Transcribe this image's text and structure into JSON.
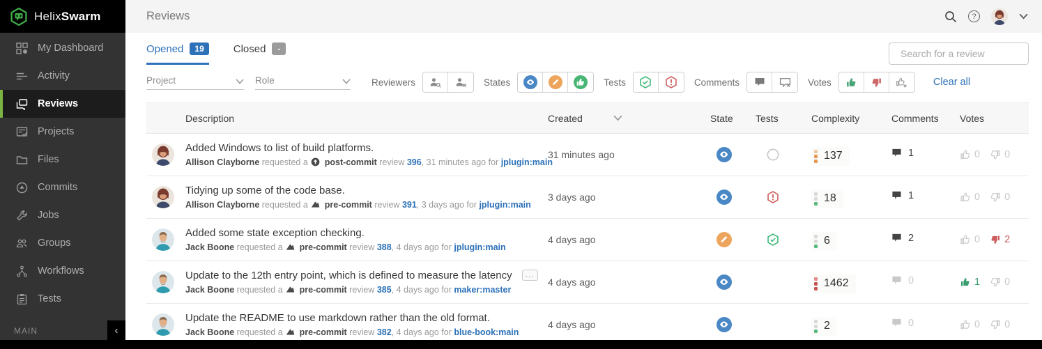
{
  "colors": {
    "accent_green": "#7db343",
    "link_blue": "#2d71b8",
    "state_review_blue": "#4a87c5",
    "state_revision_orange": "#eda55d",
    "state_approved_green": "#49b675",
    "test_pass_green": "#3cb878",
    "test_fail_red": "#cd5c5c",
    "vote_up_green": "#3a9d6e",
    "vote_down_red": "#cd5c5c",
    "sidebar_bg": "#333333"
  },
  "sidebar": {
    "brand_light": "Helix",
    "brand_bold": "Swarm",
    "logo_icon": "helix-swarm-logo",
    "items": [
      {
        "label": "My Dashboard",
        "icon": "dashboard-icon",
        "active": false
      },
      {
        "label": "Activity",
        "icon": "activity-icon",
        "active": false
      },
      {
        "label": "Reviews",
        "icon": "reviews-icon",
        "active": true
      },
      {
        "label": "Projects",
        "icon": "projects-icon",
        "active": false
      },
      {
        "label": "Files",
        "icon": "files-icon",
        "active": false
      },
      {
        "label": "Commits",
        "icon": "commits-icon",
        "active": false
      },
      {
        "label": "Jobs",
        "icon": "jobs-icon",
        "active": false
      },
      {
        "label": "Groups",
        "icon": "groups-icon",
        "active": false
      },
      {
        "label": "Workflows",
        "icon": "workflows-icon",
        "active": false
      },
      {
        "label": "Tests",
        "icon": "tests-icon",
        "active": false
      }
    ],
    "footer_label": "MAIN",
    "collapse_glyph": "‹"
  },
  "header": {
    "title": "Reviews"
  },
  "tabs": {
    "opened_label": "Opened",
    "opened_count": "19",
    "closed_label": "Closed",
    "closed_count": "-"
  },
  "search": {
    "placeholder": "Search for a review"
  },
  "filters": {
    "project_label": "Project",
    "role_label": "Role",
    "reviewers_label": "Reviewers",
    "states_label": "States",
    "tests_label": "Tests",
    "comments_label": "Comments",
    "votes_label": "Votes",
    "clear_all_label": "Clear all"
  },
  "table": {
    "columns": [
      "Description",
      "Created",
      "State",
      "Tests",
      "Complexity",
      "Comments",
      "Votes"
    ],
    "rows": [
      {
        "avatar": "avatar-allison",
        "title": "Added Windows to list of build platforms.",
        "author": "Allison Clayborne",
        "requested_text": "requested a",
        "commit_type": "post-commit",
        "commit_icon": "post-commit-icon",
        "review_word": "review",
        "review_id": "396",
        "meta_suffix": ", 31 minutes ago for",
        "branch": "jplugin:main",
        "created": "31 minutes ago",
        "state": "needs-review",
        "tests": "running",
        "complexity": "137",
        "complexity_level": "medium",
        "comments": "1",
        "comments_active": true,
        "upvotes": "0",
        "downvotes": "0",
        "upvote_active": false,
        "downvote_active": false,
        "truncated": false
      },
      {
        "avatar": "avatar-allison",
        "title": "Tidying up some of the code base.",
        "author": "Allison Clayborne",
        "requested_text": "requested a",
        "commit_type": "pre-commit",
        "commit_icon": "pre-commit-icon",
        "review_word": "review",
        "review_id": "391",
        "meta_suffix": ", 3 days ago for",
        "branch": "jplugin:main",
        "created": "3 days ago",
        "state": "needs-review",
        "tests": "failed",
        "complexity": "18",
        "complexity_level": "low",
        "comments": "1",
        "comments_active": true,
        "upvotes": "0",
        "downvotes": "0",
        "upvote_active": false,
        "downvote_active": false,
        "truncated": false
      },
      {
        "avatar": "avatar-jack",
        "title": "Added some state exception checking.",
        "author": "Jack Boone",
        "requested_text": "requested a",
        "commit_type": "pre-commit",
        "commit_icon": "pre-commit-icon",
        "review_word": "review",
        "review_id": "388",
        "meta_suffix": ", 4 days ago for",
        "branch": "jplugin:main",
        "created": "4 days ago",
        "state": "needs-revision",
        "tests": "passed",
        "complexity": "6",
        "complexity_level": "low",
        "comments": "2",
        "comments_active": true,
        "upvotes": "0",
        "downvotes": "2",
        "upvote_active": false,
        "downvote_active": true,
        "truncated": false
      },
      {
        "avatar": "avatar-jack",
        "title": "Update to the 12th entry point, which is defined to measure the latency",
        "author": "Jack Boone",
        "requested_text": "requested a",
        "commit_type": "pre-commit",
        "commit_icon": "pre-commit-icon",
        "review_word": "review",
        "review_id": "385",
        "meta_suffix": ", 4 days ago for",
        "branch": "maker:master",
        "created": "4 days ago",
        "state": "needs-review",
        "tests": "none",
        "complexity": "1462",
        "complexity_level": "high",
        "comments": "0",
        "comments_active": false,
        "upvotes": "1",
        "downvotes": "0",
        "upvote_active": true,
        "downvote_active": false,
        "truncated": true,
        "expand_glyph": "..."
      },
      {
        "avatar": "avatar-jack",
        "title": "Update the README to use markdown rather than the old format.",
        "author": "Jack Boone",
        "requested_text": "requested a",
        "commit_type": "pre-commit",
        "commit_icon": "pre-commit-icon",
        "review_word": "review",
        "review_id": "382",
        "meta_suffix": ", 4 days ago for",
        "branch": "blue-book:main",
        "created": "4 days ago",
        "state": "needs-review",
        "tests": "none",
        "complexity": "2",
        "complexity_level": "low",
        "comments": "0",
        "comments_active": false,
        "upvotes": "0",
        "downvotes": "0",
        "upvote_active": false,
        "downvote_active": false,
        "truncated": false
      }
    ]
  }
}
